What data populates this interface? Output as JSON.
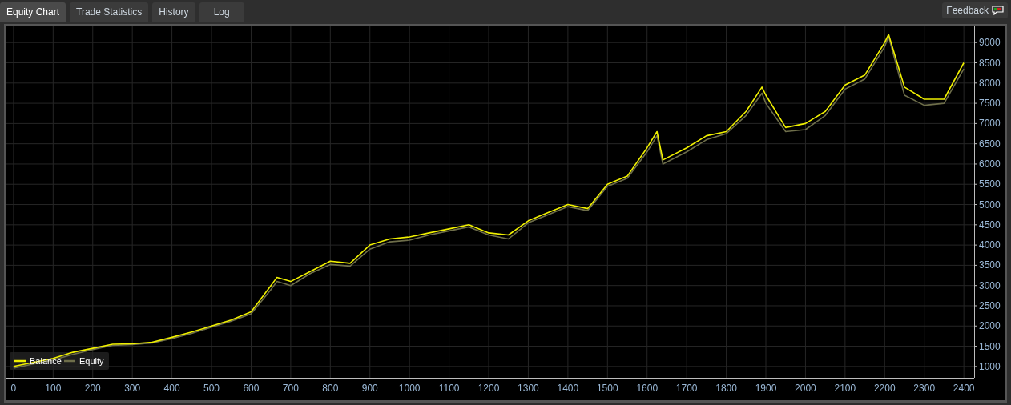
{
  "tabs": [
    {
      "label": "Equity Chart",
      "selected": true
    },
    {
      "label": "Trade Statistics",
      "selected": false
    },
    {
      "label": "History",
      "selected": false
    },
    {
      "label": "Log",
      "selected": false
    }
  ],
  "feedback": {
    "label": "Feedback"
  },
  "chart": {
    "chart_data": {
      "type": "line",
      "grid": true,
      "legend": true,
      "xlim": [
        -18,
        2426
      ],
      "ylim": [
        720,
        9400
      ],
      "x": [
        0,
        50,
        100,
        150,
        200,
        250,
        300,
        350,
        400,
        450,
        500,
        550,
        600,
        650,
        665,
        700,
        750,
        800,
        850,
        900,
        950,
        1000,
        1050,
        1100,
        1150,
        1200,
        1250,
        1300,
        1350,
        1400,
        1450,
        1500,
        1550,
        1600,
        1625,
        1640,
        1700,
        1750,
        1800,
        1850,
        1890,
        1900,
        1950,
        2000,
        2050,
        2100,
        2150,
        2200,
        2210,
        2250,
        2300,
        2350,
        2400
      ],
      "series": [
        {
          "name": "Equity",
          "color": "#6e6e4a",
          "values": [
            960,
            1060,
            1160,
            1300,
            1420,
            1520,
            1540,
            1580,
            1690,
            1820,
            1970,
            2120,
            2300,
            2900,
            3100,
            3000,
            3300,
            3520,
            3480,
            3900,
            4080,
            4120,
            4250,
            4350,
            4450,
            4250,
            4150,
            4550,
            4750,
            4950,
            4850,
            5450,
            5650,
            6300,
            6700,
            6000,
            6300,
            6600,
            6750,
            7200,
            7750,
            7500,
            6800,
            6850,
            7200,
            7850,
            8100,
            8900,
            9150,
            7700,
            7450,
            7500,
            8350
          ]
        },
        {
          "name": "Balance",
          "color": "#f0f000",
          "values": [
            1000,
            1100,
            1200,
            1350,
            1450,
            1550,
            1560,
            1600,
            1720,
            1850,
            2000,
            2150,
            2350,
            3000,
            3200,
            3100,
            3350,
            3600,
            3550,
            4000,
            4150,
            4200,
            4300,
            4400,
            4500,
            4300,
            4250,
            4600,
            4800,
            5000,
            4900,
            5500,
            5700,
            6400,
            6800,
            6100,
            6400,
            6700,
            6800,
            7300,
            7900,
            7700,
            6900,
            7000,
            7300,
            7950,
            8200,
            9000,
            9200,
            7900,
            7600,
            7600,
            8500
          ]
        }
      ],
      "xticks": [
        0,
        100,
        200,
        300,
        400,
        500,
        600,
        700,
        800,
        900,
        1000,
        1100,
        1200,
        1300,
        1400,
        1500,
        1600,
        1700,
        1800,
        1900,
        2000,
        2100,
        2200,
        2300,
        2400
      ],
      "yticks": [
        1000,
        1500,
        2000,
        2500,
        3000,
        3500,
        4000,
        4500,
        5000,
        5500,
        6000,
        6500,
        7000,
        7500,
        8000,
        8500,
        9000
      ]
    }
  }
}
